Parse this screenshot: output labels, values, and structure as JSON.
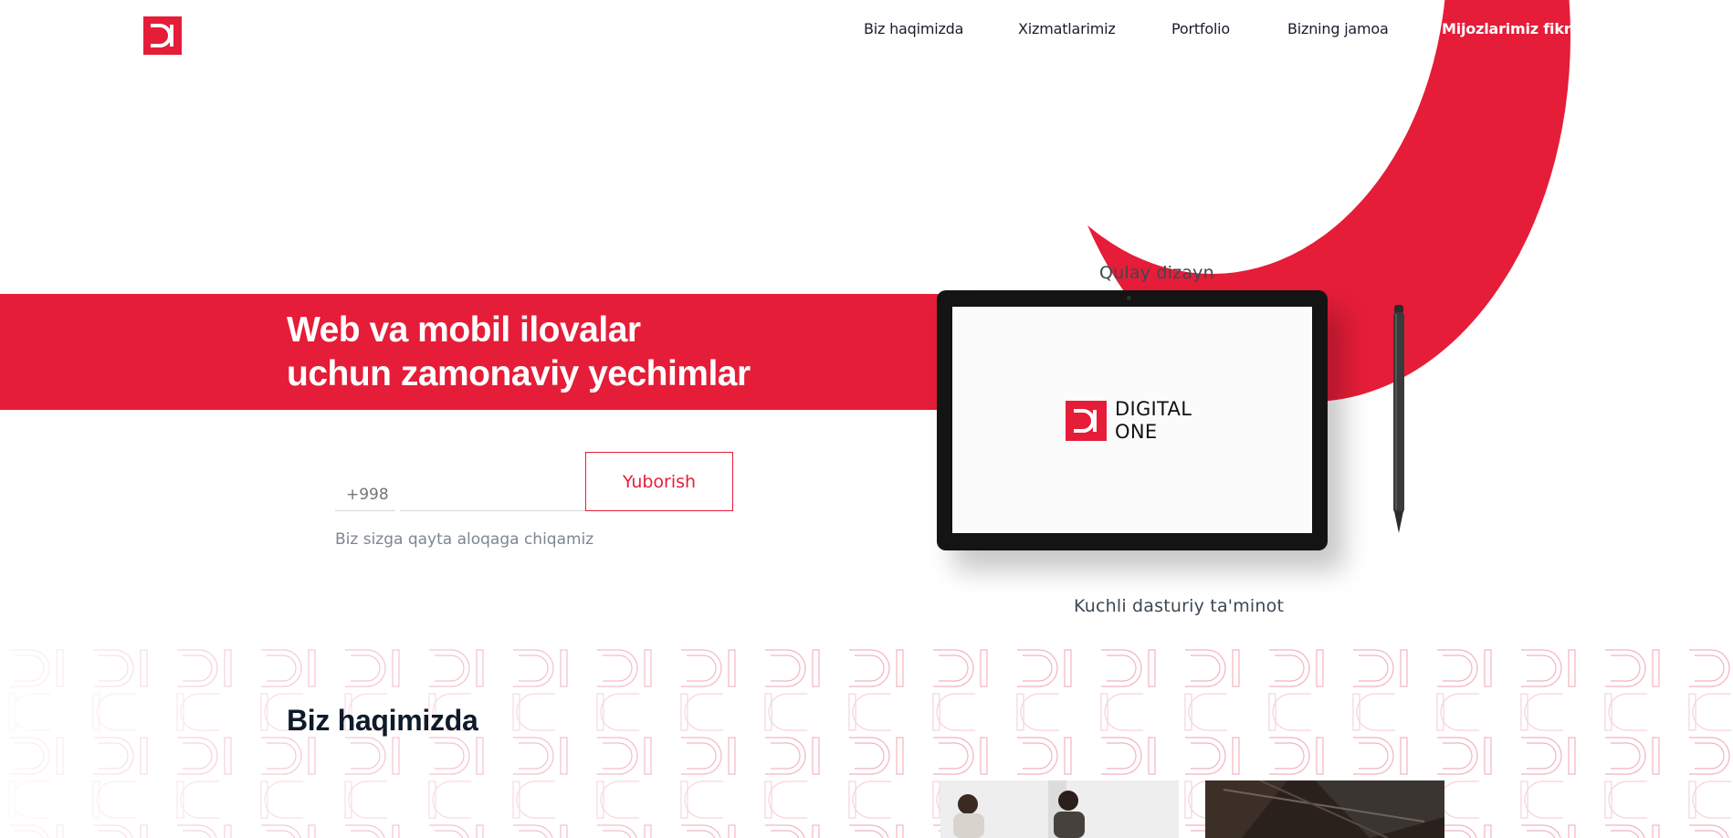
{
  "nav": {
    "items": [
      {
        "label": "Biz haqimizda"
      },
      {
        "label": "Xizmatlarimiz"
      },
      {
        "label": "Portfolio"
      },
      {
        "label": "Bizning jamoa"
      },
      {
        "label": "Mijozlarimiz fikri"
      }
    ]
  },
  "hero": {
    "title_line1": "Web va mobil ilovalar",
    "title_line2": "uchun zamonaviy yechimlar"
  },
  "form": {
    "phone_prefix_placeholder": "+998",
    "phone_value": "",
    "submit_label": "Yuborish",
    "note": "Biz sizga qayta aloqaga chiqamiz"
  },
  "showcase": {
    "feature_top": "Qulay dizayn",
    "feature_bottom": "Kuchli dasturiy ta'minot",
    "screen_brand_line1": "DIGITAL",
    "screen_brand_line2": "ONE"
  },
  "about": {
    "title": "Biz haqimizda"
  },
  "colors": {
    "brand_red": "#e51d38",
    "heading": "#0d1b2a",
    "muted_text": "#7d8690"
  }
}
